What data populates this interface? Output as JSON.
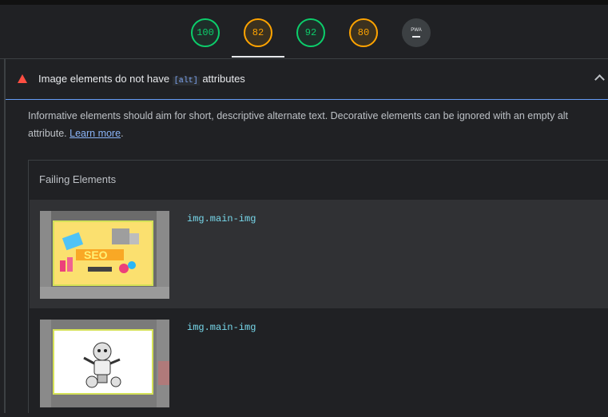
{
  "scores": {
    "performance": "100",
    "accessibility": "82",
    "best_practices": "92",
    "seo": "80",
    "pwa_label": "PWA"
  },
  "colors": {
    "pass": "#0cce6b",
    "average": "#ffa400",
    "fail": "#ff4e42",
    "link": "#8ab4f8",
    "code": "#78d9ec"
  },
  "audit": {
    "title_prefix": "Image elements do not have",
    "title_code": "[alt]",
    "title_suffix": "attributes",
    "description": "Informative elements should aim for short, descriptive alternate text. Decorative elements can be ignored with an empty alt attribute.",
    "learn_more": "Learn more",
    "period": "."
  },
  "table": {
    "header": "Failing Elements",
    "rows": [
      {
        "selector": "img.main-img",
        "thumb": "seo-illustration"
      },
      {
        "selector": "img.main-img",
        "thumb": "robot-illustration"
      }
    ]
  }
}
